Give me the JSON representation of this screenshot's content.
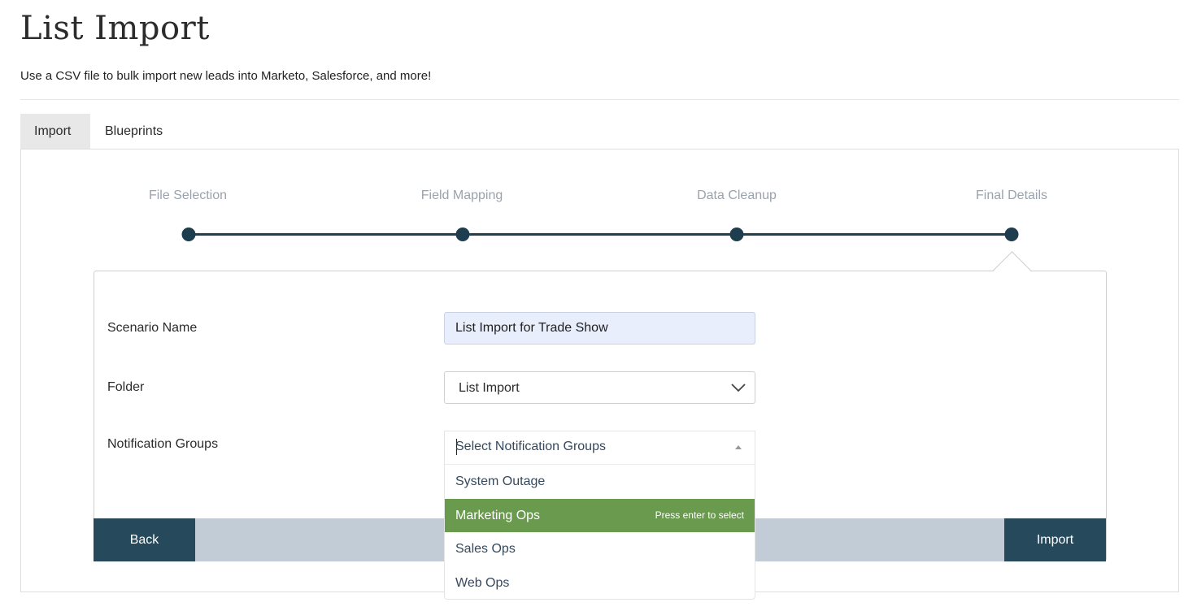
{
  "page": {
    "title": "List Import",
    "subtitle": "Use a CSV file to bulk import new leads into Marketo, Salesforce, and more!"
  },
  "tabs": [
    {
      "label": "Import",
      "active": true
    },
    {
      "label": "Blueprints",
      "active": false
    }
  ],
  "steps": [
    {
      "label": "File Selection"
    },
    {
      "label": "Field Mapping"
    },
    {
      "label": "Data Cleanup"
    },
    {
      "label": "Final Details"
    }
  ],
  "form": {
    "scenario_name": {
      "label": "Scenario Name",
      "value": "List Import for Trade Show"
    },
    "folder": {
      "label": "Folder",
      "value": "List Import",
      "icon": "chevron-down-icon"
    },
    "notification_groups": {
      "label": "Notification Groups",
      "placeholder": "Select Notification Groups",
      "options": [
        "System Outage",
        "Marketing Ops",
        "Sales Ops",
        "Web Ops"
      ],
      "highlighted_option": "Marketing Ops",
      "hint": "Press enter to select"
    }
  },
  "footer": {
    "back_label": "Back",
    "import_label": "Import"
  },
  "colors": {
    "accent": "#264a5c",
    "step_track": "#1e3d4f",
    "highlight": "#6a9a4e",
    "footer_bar": "#c2ccd6",
    "input_fill": "#e8eefc"
  }
}
